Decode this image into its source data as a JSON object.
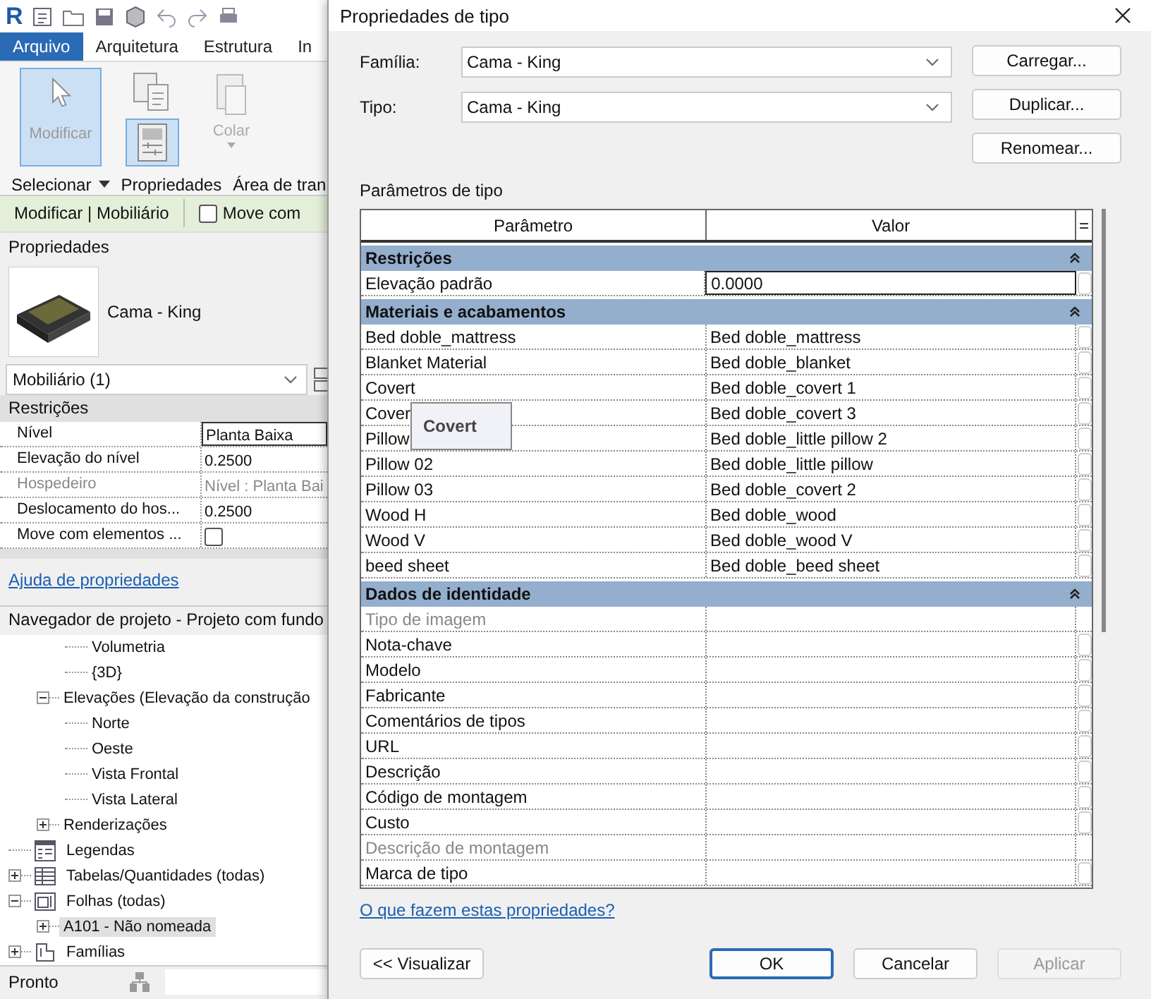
{
  "app_logo": "R",
  "ribbon": {
    "tabs": [
      {
        "label": "Arquivo",
        "selected": true
      },
      {
        "label": "Arquitetura",
        "selected": false
      },
      {
        "label": "Estrutura",
        "selected": false
      },
      {
        "label": "In",
        "selected": false
      }
    ],
    "modify_tool": {
      "label": "Modificar",
      "selected": true
    },
    "properties_tools": [
      {
        "selected": false
      },
      {
        "selected": true
      }
    ],
    "paste_tool": {
      "label": "Colar",
      "disabled": true
    },
    "panels": [
      {
        "label": "Selecionar",
        "dropdown": true
      },
      {
        "label": "Propriedades",
        "dropdown": false
      },
      {
        "label": "Área de tran",
        "dropdown": false
      }
    ]
  },
  "context_bar": {
    "title": "Modificar | Mobiliário",
    "option": {
      "label": "Move com",
      "checked": false
    }
  },
  "properties": {
    "title": "Propriedades",
    "type_name": "Cama - King",
    "filter": "Mobiliário (1)",
    "group": "Restrições",
    "rows": [
      {
        "kind": "field",
        "name": "Nível",
        "value": "Planta Baixa",
        "disabled": false
      },
      {
        "kind": "text",
        "name": "Elevação do nível",
        "value": "0.2500",
        "disabled": false
      },
      {
        "kind": "text",
        "name": "Hospedeiro",
        "value": "Nível : Planta Bai",
        "disabled": true
      },
      {
        "kind": "text",
        "name": "Deslocamento do hos...",
        "value": "0.2500",
        "disabled": false
      },
      {
        "kind": "checkbox",
        "name": "Move com elementos ...",
        "checked": false,
        "disabled": false
      }
    ],
    "help_link": "Ajuda de propriedades"
  },
  "browser": {
    "title": "Navegador de projeto - Projeto com fundo",
    "tree": [
      {
        "children": [
          {
            "children": [
              {
                "label": "Volumetria",
                "selected": false
              },
              {
                "label": "{3D}",
                "selected": false
              }
            ]
          },
          {
            "label": "Elevações (Elevação da construção",
            "selected": false,
            "expanded": true,
            "children": [
              {
                "label": "Norte",
                "selected": false
              },
              {
                "label": "Oeste",
                "selected": false
              },
              {
                "label": "Vista Frontal",
                "selected": false
              },
              {
                "label": "Vista Lateral",
                "selected": false
              }
            ]
          },
          {
            "label": "Renderizações",
            "selected": false,
            "expanded": false
          }
        ]
      },
      {
        "kind": "legend",
        "label": "Legendas",
        "selected": false
      },
      {
        "kind": "schedule",
        "label": "Tabelas/Quantidades (todas)",
        "selected": false,
        "expanded": false
      },
      {
        "kind": "sheet",
        "label": "Folhas (todas)",
        "selected": false,
        "expanded": true,
        "children": [
          {
            "label": "A101 - Não nomeada",
            "selected": true,
            "expanded": false
          }
        ]
      },
      {
        "kind": "family",
        "label": "Famílias",
        "selected": false,
        "expanded": false
      }
    ]
  },
  "status_bar": {
    "text": "Pronto"
  },
  "dialog": {
    "title": "Propriedades de tipo",
    "family": {
      "label": "Família:",
      "value": "Cama - King"
    },
    "type": {
      "label": "Tipo:",
      "value": "Cama - King"
    },
    "side_buttons": [
      "Carregar...",
      "Duplicar...",
      "Renomear..."
    ],
    "params_label": "Parâmetros de tipo",
    "columns": [
      "Parâmetro",
      "Valor",
      "="
    ],
    "groups": [
      {
        "title": "Restrições",
        "rows": [
          {
            "name": "Elevação padrão",
            "value": "0.0000",
            "disabled": false,
            "editing": true
          }
        ]
      },
      {
        "title": "Materiais e acabamentos",
        "rows": [
          {
            "name": "Bed doble_mattress",
            "value": "Bed doble_mattress",
            "disabled": false,
            "editing": false
          },
          {
            "name": "Blanket Material",
            "value": "Bed doble_blanket",
            "disabled": false,
            "editing": false
          },
          {
            "name": "Covert",
            "value": "Bed doble_covert 1",
            "disabled": false,
            "editing": false
          },
          {
            "name": "Cover",
            "value": "Bed doble_covert 3",
            "disabled": false,
            "editing": false
          },
          {
            "name": "Pillow",
            "value": "Bed doble_little pillow 2",
            "disabled": false,
            "editing": false
          },
          {
            "name": "Pillow 02",
            "value": "Bed doble_little pillow",
            "disabled": false,
            "editing": false
          },
          {
            "name": "Pillow 03",
            "value": "Bed doble_covert 2",
            "disabled": false,
            "editing": false
          },
          {
            "name": "Wood H",
            "value": "Bed doble_wood",
            "disabled": false,
            "editing": false
          },
          {
            "name": "Wood V",
            "value": "Bed doble_wood V",
            "disabled": false,
            "editing": false
          },
          {
            "name": "beed sheet",
            "value": "Bed doble_beed sheet",
            "disabled": false,
            "editing": false
          }
        ]
      },
      {
        "title": "Dados de identidade",
        "rows": [
          {
            "name": "Tipo de imagem",
            "disabled": true,
            "editing": false
          },
          {
            "name": "Nota-chave",
            "disabled": false,
            "editing": false
          },
          {
            "name": "Modelo",
            "disabled": false,
            "editing": false
          },
          {
            "name": "Fabricante",
            "disabled": false,
            "editing": false
          },
          {
            "name": "Comentários de tipos",
            "disabled": false,
            "editing": false
          },
          {
            "name": "URL",
            "disabled": false,
            "editing": false
          },
          {
            "name": "Descrição",
            "disabled": false,
            "editing": false
          },
          {
            "name": "Código de montagem",
            "disabled": false,
            "editing": false
          },
          {
            "name": "Custo",
            "disabled": false,
            "editing": false
          },
          {
            "name": "Descrição de montagem",
            "disabled": true,
            "editing": false
          },
          {
            "name": "Marca de tipo",
            "disabled": false,
            "editing": false
          }
        ]
      }
    ],
    "tooltip": "Covert",
    "help_link": "O que fazem estas propriedades?",
    "preview_button": "<< Visualizar",
    "buttons": [
      {
        "label": "OK",
        "default": true,
        "disabled": false
      },
      {
        "label": "Cancelar",
        "default": false,
        "disabled": false
      },
      {
        "label": "Aplicar",
        "default": false,
        "disabled": true
      }
    ]
  }
}
